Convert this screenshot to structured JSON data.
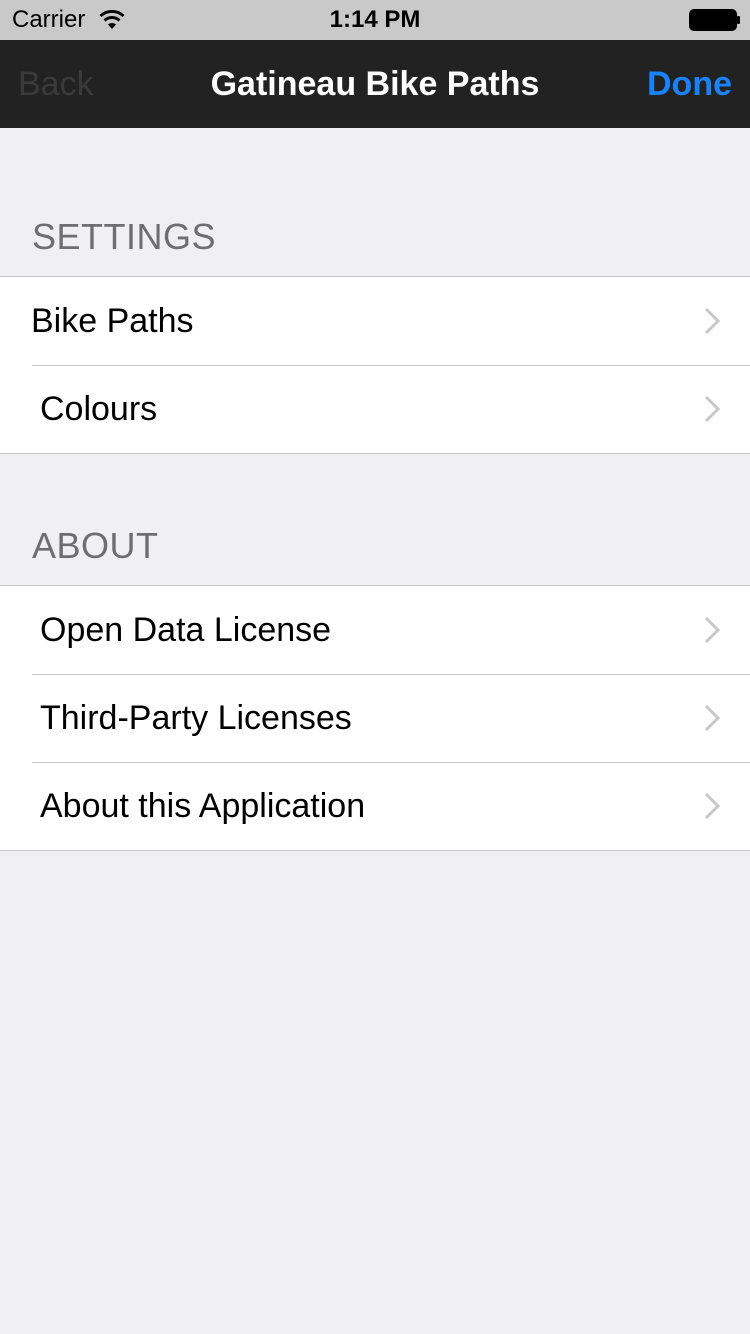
{
  "status_bar": {
    "carrier": "Carrier",
    "time": "1:14 PM",
    "wifi_icon": "wifi-icon",
    "battery_icon": "battery-icon"
  },
  "nav": {
    "back_label": "Back",
    "title": "Gatineau Bike Paths",
    "done_label": "Done",
    "done_color": "#1a82f7",
    "bar_color": "#222222"
  },
  "sections": [
    {
      "header": "SETTINGS",
      "items": [
        {
          "label": "Bike Paths",
          "icon": "chevron-right-icon"
        },
        {
          "label": "Colours",
          "icon": "chevron-right-icon"
        }
      ]
    },
    {
      "header": "ABOUT",
      "items": [
        {
          "label": "Open Data License",
          "icon": "chevron-right-icon"
        },
        {
          "label": "Third-Party Licenses",
          "icon": "chevron-right-icon"
        },
        {
          "label": "About this Application",
          "icon": "chevron-right-icon"
        }
      ]
    }
  ]
}
